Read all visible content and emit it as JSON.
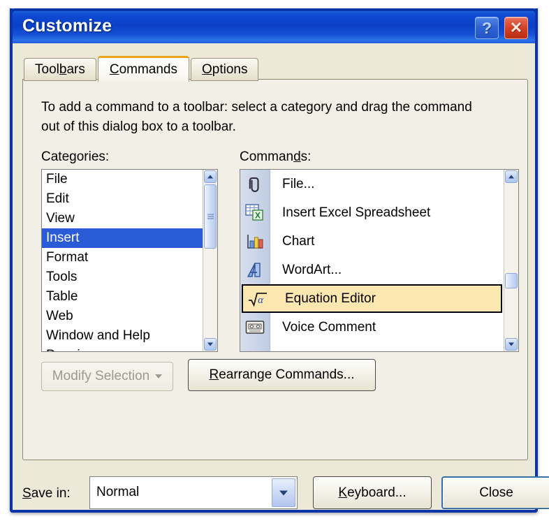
{
  "window": {
    "title": "Customize",
    "help_button": "?",
    "close_button": "✕"
  },
  "tabs": [
    {
      "label_pre": "Tool",
      "accel": "b",
      "label_post": "ars",
      "active": false,
      "name": "tab-toolbars"
    },
    {
      "label_pre": "",
      "accel": "C",
      "label_post": "ommands",
      "active": true,
      "name": "tab-commands"
    },
    {
      "label_pre": "",
      "accel": "O",
      "label_post": "ptions",
      "active": false,
      "name": "tab-options"
    }
  ],
  "panel": {
    "instructions": "To add a command to a toolbar: select a category and drag the command out of this dialog box to a toolbar.",
    "categories_label_pre": "Cate",
    "categories_label_accel": "g",
    "categories_label_post": "ories:",
    "commands_label_pre": "Comman",
    "commands_label_accel": "d",
    "commands_label_post": "s:"
  },
  "categories": {
    "items": [
      {
        "label": "File",
        "selected": false
      },
      {
        "label": "Edit",
        "selected": false
      },
      {
        "label": "View",
        "selected": false
      },
      {
        "label": "Insert",
        "selected": true
      },
      {
        "label": "Format",
        "selected": false
      },
      {
        "label": "Tools",
        "selected": false
      },
      {
        "label": "Table",
        "selected": false
      },
      {
        "label": "Web",
        "selected": false
      },
      {
        "label": "Window and Help",
        "selected": false
      },
      {
        "label": "Drawing",
        "selected": false
      }
    ]
  },
  "commands": {
    "items": [
      {
        "label": "File...",
        "icon": "paperclip-icon",
        "hovered": false
      },
      {
        "label": "Insert Excel Spreadsheet",
        "icon": "excel-spreadsheet-icon",
        "hovered": false
      },
      {
        "label": "Chart",
        "icon": "chart-icon",
        "hovered": false
      },
      {
        "label": "WordArt...",
        "icon": "wordart-icon",
        "hovered": false
      },
      {
        "label": "Equation Editor",
        "icon": "equation-editor-icon",
        "hovered": true
      },
      {
        "label": "Voice Comment",
        "icon": "cassette-tape-icon",
        "hovered": false
      }
    ]
  },
  "buttons": {
    "modify_selection": "Modify Selection",
    "rearrange_pre": "",
    "rearrange_accel": "R",
    "rearrange_post": "earrange Commands...",
    "keyboard_pre": "",
    "keyboard_accel": "K",
    "keyboard_post": "eyboard...",
    "close": "Close"
  },
  "save_in": {
    "label_pre": "",
    "label_accel": "S",
    "label_post": "ave in:",
    "value": "Normal"
  },
  "colors": {
    "titlebar_blue": "#0B41C8",
    "dialog_face": "#ECE9D8",
    "selection_blue": "#2B5CD8",
    "hover_amber": "#FBE7AF",
    "active_tab_accent": "#E8A317",
    "close_red": "#D6452A"
  }
}
